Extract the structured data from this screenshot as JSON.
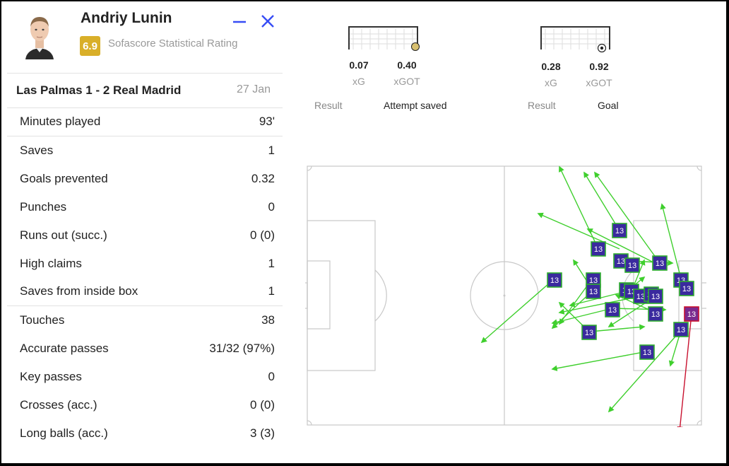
{
  "player": {
    "name": "Andriy Lunin",
    "rating": "6.9",
    "rating_label": "Sofascore Statistical Rating"
  },
  "match": {
    "title": "Las Palmas 1 - 2 Real Madrid",
    "date": "27 Jan"
  },
  "stats": [
    {
      "label": "Minutes played",
      "value": "93'"
    },
    {
      "label": "Saves",
      "value": "1"
    },
    {
      "label": "Goals prevented",
      "value": "0.32"
    },
    {
      "label": "Punches",
      "value": "0"
    },
    {
      "label": "Runs out (succ.)",
      "value": "0 (0)"
    },
    {
      "label": "High claims",
      "value": "1"
    },
    {
      "label": "Saves from inside box",
      "value": "1"
    },
    {
      "label": "Touches",
      "value": "38"
    },
    {
      "label": "Accurate passes",
      "value": "31/32 (97%)"
    },
    {
      "label": "Key passes",
      "value": "0"
    },
    {
      "label": "Crosses (acc.)",
      "value": "0 (0)"
    },
    {
      "label": "Long balls (acc.)",
      "value": "3 (3)"
    }
  ],
  "shots": [
    {
      "xg": "0.07",
      "xg_label": "xG",
      "xgot": "0.40",
      "xgot_label": "xGOT",
      "result_label": "Result",
      "result": "Attempt saved",
      "marker": "ball-saved-icon"
    },
    {
      "xg": "0.28",
      "xg_label": "xG",
      "xgot": "0.92",
      "xgot_label": "xGOT",
      "result_label": "Result",
      "result": "Goal",
      "marker": "ball-goal-icon"
    }
  ],
  "pass_map": {
    "jersey": "13",
    "colors": {
      "accurate": "#3fcf2d",
      "inaccurate": "#c8102e",
      "marker_fill": "#3a2a9e",
      "marker_border_ok": "#2fae2f",
      "marker_border_bad": "#c8102e",
      "pitch_line": "#c8c8c8"
    }
  }
}
